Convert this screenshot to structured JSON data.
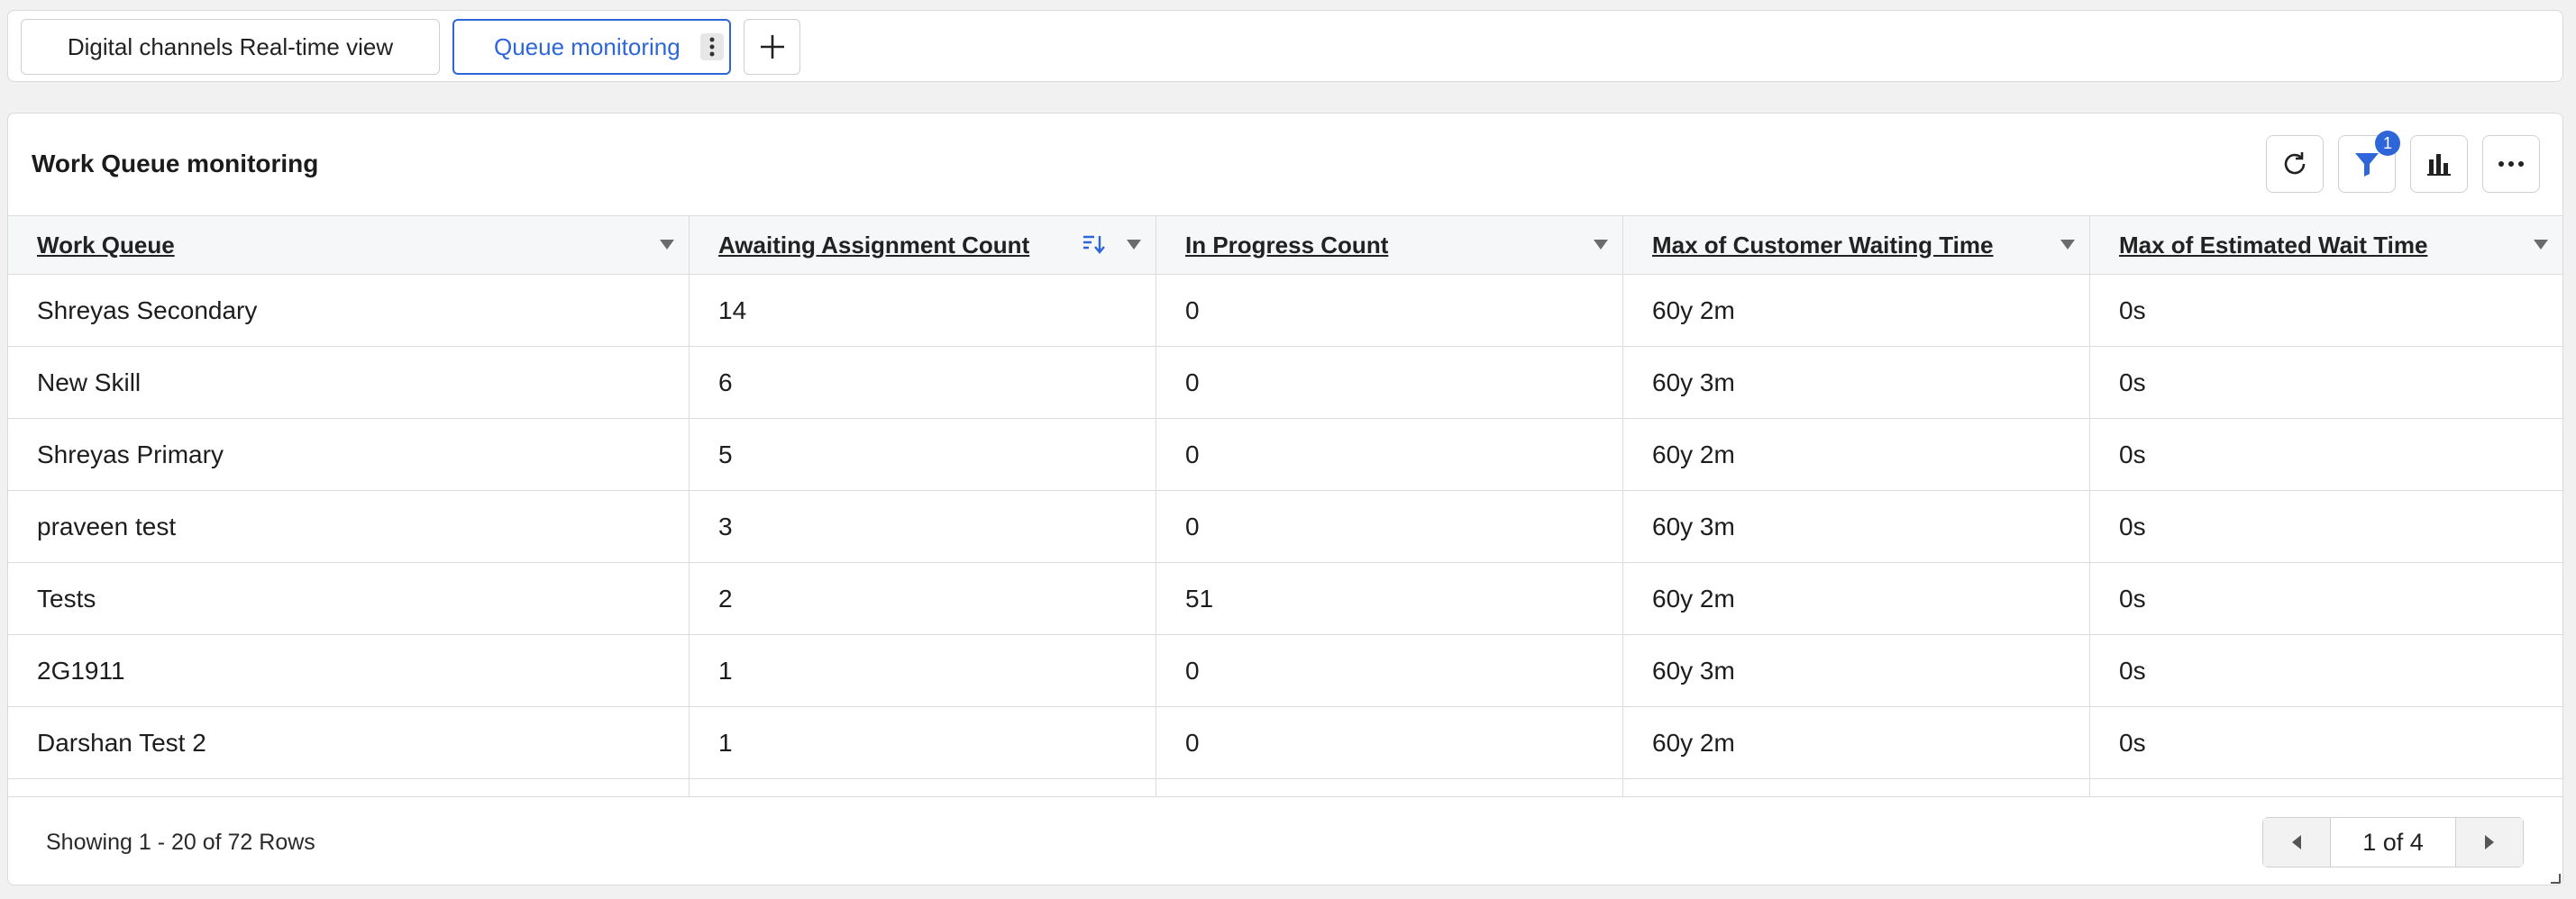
{
  "tabs": [
    {
      "label": "Digital channels Real-time view"
    },
    {
      "label": "Queue monitoring"
    }
  ],
  "panel": {
    "title": "Work Queue monitoring",
    "filter_badge": "1"
  },
  "table": {
    "columns": [
      {
        "label": "Work Queue"
      },
      {
        "label": "Awaiting Assignment Count"
      },
      {
        "label": "In Progress Count"
      },
      {
        "label": "Max of Customer Waiting Time"
      },
      {
        "label": "Max of Estimated Wait Time"
      }
    ],
    "rows": [
      [
        "Shreyas Secondary",
        "14",
        "0",
        "60y 2m",
        "0s"
      ],
      [
        "New Skill",
        "6",
        "0",
        "60y 3m",
        "0s"
      ],
      [
        "Shreyas Primary",
        "5",
        "0",
        "60y 2m",
        "0s"
      ],
      [
        "praveen test",
        "3",
        "0",
        "60y 3m",
        "0s"
      ],
      [
        "Tests",
        "2",
        "51",
        "60y 2m",
        "0s"
      ],
      [
        "2G1911",
        "1",
        "0",
        "60y 3m",
        "0s"
      ],
      [
        "Darshan Test 2",
        "1",
        "0",
        "60y 2m",
        "0s"
      ]
    ]
  },
  "footer": {
    "row_count": "Showing 1 - 20 of 72 Rows",
    "page": "1 of 4"
  },
  "colors": {
    "accent": "#2e66d9",
    "border": "#dcdcdc"
  },
  "icons": [
    "more-vertical-icon",
    "plus-icon",
    "refresh-icon",
    "filter-icon",
    "bar-chart-icon",
    "more-horizontal-icon",
    "sort-icon",
    "caret-down-icon",
    "chevron-left-icon",
    "chevron-right-icon",
    "resize-handle-icon"
  ]
}
